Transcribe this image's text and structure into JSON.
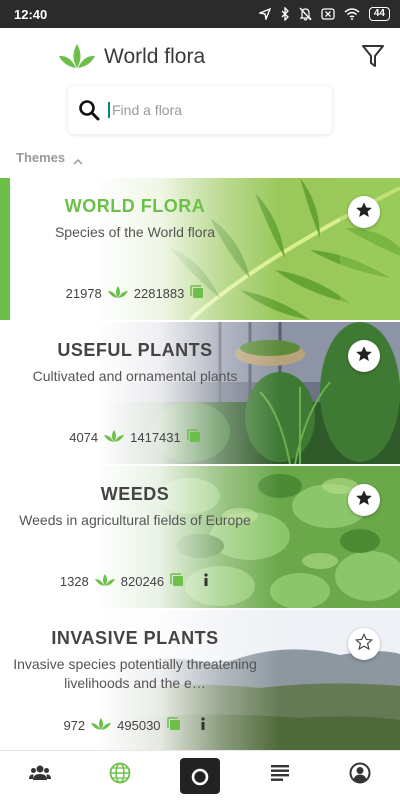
{
  "status_bar": {
    "time": "12:40",
    "battery": "44",
    "icons": [
      "location-arrow-icon",
      "bluetooth-icon",
      "bell-off-icon",
      "no-sim-icon",
      "wifi-icon",
      "battery-icon"
    ]
  },
  "header": {
    "title": "World flora",
    "logo_icon": "leaf-logo-icon",
    "filter_icon": "filter-icon"
  },
  "search": {
    "placeholder": "Find a flora",
    "value": ""
  },
  "themes": {
    "label": "Themes",
    "expanded": true
  },
  "cards": [
    {
      "title": "WORLD FLORA",
      "description": "Species of the World flora",
      "species_count": "21978",
      "observations_count": "2281883",
      "active": true,
      "favorite": true,
      "info": false
    },
    {
      "title": "USEFUL PLANTS",
      "description": "Cultivated and ornamental plants",
      "species_count": "4074",
      "observations_count": "1417431",
      "active": false,
      "favorite": true,
      "info": false
    },
    {
      "title": "WEEDS",
      "description": "Weeds in agricultural fields of Europe",
      "species_count": "1328",
      "observations_count": "820246",
      "active": false,
      "favorite": true,
      "info": true
    },
    {
      "title": "INVASIVE PLANTS",
      "description": "Invasive species potentially threatening livelihoods and the e…",
      "species_count": "972",
      "observations_count": "495030",
      "active": false,
      "favorite": false,
      "info": true
    }
  ],
  "bottom_nav": [
    {
      "icon": "group-icon"
    },
    {
      "icon": "globe-icon",
      "active": true
    },
    {
      "icon": "camera-icon"
    },
    {
      "icon": "list-icon"
    },
    {
      "icon": "profile-icon"
    }
  ],
  "colors": {
    "accent": "#6cc04a",
    "cursor": "#00897b",
    "status_bar": "#2b2b2b"
  }
}
